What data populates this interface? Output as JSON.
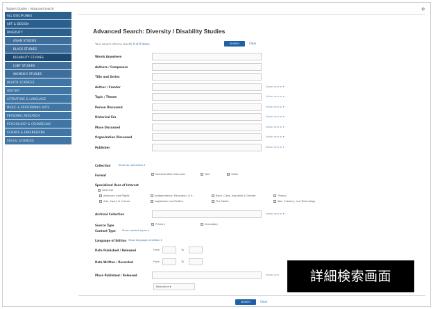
{
  "sidebar": {
    "crumb": "Subject Guides  ›  Advanced search",
    "items": [
      {
        "label": "ALL DISCIPLINES",
        "kind": "blue"
      },
      {
        "label": "ART & DESIGN",
        "kind": "blue"
      },
      {
        "label": "DIVERSITY",
        "kind": "blue"
      },
      {
        "label": "ASIAN STUDIES",
        "kind": "blue-sub"
      },
      {
        "label": "BLACK STUDIES",
        "kind": "blue-sub"
      },
      {
        "label": "DISABILITY STUDIES",
        "kind": "active"
      },
      {
        "label": "LGBT STUDIES",
        "kind": "blue-sub"
      },
      {
        "label": "WOMEN'S STUDIES",
        "kind": "blue-sub"
      },
      {
        "label": "HEALTH SCIENCES",
        "kind": "light"
      },
      {
        "label": "HISTORY",
        "kind": "light"
      },
      {
        "label": "LITERATURE & LANGUAGE",
        "kind": "light"
      },
      {
        "label": "MUSIC & PERFORMING ARTS",
        "kind": "light"
      },
      {
        "label": "PERSONAL RESEARCH",
        "kind": "light"
      },
      {
        "label": "PSYCHOLOGY & COUNSELING",
        "kind": "light"
      },
      {
        "label": "SCIENCE & ENGINEERING",
        "kind": "light"
      },
      {
        "label": "SOCIAL SCIENCES",
        "kind": "light"
      }
    ]
  },
  "main": {
    "title": "Advanced Search: Diversity / Disability Studies",
    "hint_prefix": "Your search returns results",
    "hint_link": "0 of 0 items",
    "search_label": "SEARCH",
    "clear_label": "Clear",
    "fields": [
      {
        "label": "Words Anywhere",
        "select_more": ""
      },
      {
        "label": "Authors / Composers",
        "select_more": ""
      },
      {
        "label": "Title and Series",
        "select_more": ""
      },
      {
        "label": "Author / Creator",
        "select_more": "Select one or ▾"
      },
      {
        "label": "Topic / Theme",
        "select_more": "Select one or ▾"
      },
      {
        "label": "Person Discussed",
        "select_more": "Select one or ▾"
      },
      {
        "label": "Historical Era",
        "select_more": "Select one or ▾"
      },
      {
        "label": "Place Discussed",
        "select_more": "Select one or ▾"
      },
      {
        "label": "Organization Discussed",
        "select_more": "Select one or ▾"
      },
      {
        "label": "Publisher",
        "select_more": "Select one or ▾"
      }
    ],
    "collection_label": "Collection",
    "collection_link": "Show all collections ▾",
    "format_label": "Format",
    "format_options": [
      "Selected Web resources",
      "Text",
      "Video"
    ],
    "specialized_label": "Specialized Uses of Interest",
    "select_all": "Select all",
    "interests_row1": [
      "Advocacy and Rights",
      "Independence, Education, & E...",
      "Race, Class, Sexuality & Gender",
      "Theory"
    ],
    "interests_row2": [
      "Arts, Sport, & Culture",
      "Legislation and Politics",
      "The Media",
      "War, Industry, and Technology"
    ],
    "archival_label": "Archival Collection",
    "archival_more": "Select one or ▾",
    "source_type_label": "Source Type",
    "source_type_options": [
      "Primary",
      "Secondary"
    ],
    "content_type_label": "Content Type",
    "content_type_link": "Show content types ▾",
    "language_label": "Language of Edition",
    "language_link": "Show language of edition ▾",
    "date_published_label": "Date Published / Released",
    "date_written_label": "Date Written / Recorded",
    "from_label": "From",
    "to_label": "To",
    "place_published_label": "Place Published / Released",
    "place_more": "Select one",
    "sort_label": "Relevance"
  },
  "caption": "詳細検索画面"
}
